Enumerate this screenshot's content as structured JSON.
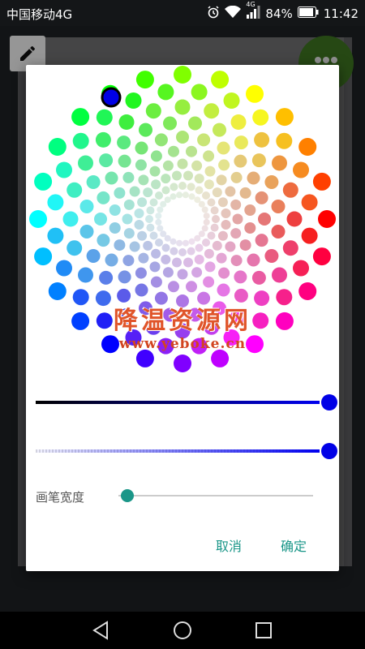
{
  "status_bar": {
    "carrier": "中国移动4G",
    "network_badge": "4G",
    "battery": "84%",
    "time": "11:42",
    "icons": [
      "alarm-icon",
      "wifi-icon",
      "signal-icon",
      "battery-icon"
    ]
  },
  "toolbar": {
    "pencil_icon": "pencil-icon",
    "menu_icon": "more-dots-icon",
    "fab_color": "#3b6f1f"
  },
  "dialog": {
    "selected_color": "#0000e6",
    "value_slider_level": 1.0,
    "alpha_slider_level": 1.0,
    "brush_width_label": "画笔宽度",
    "brush_width_level": 0.04,
    "cancel_label": "取消",
    "confirm_label": "确定",
    "accent_color": "#1a9688"
  },
  "watermark": {
    "title": "降温资源网",
    "url": "www.yeboke.cn"
  },
  "nav_bar": {
    "icons": [
      "back-icon",
      "home-icon",
      "recents-icon"
    ]
  }
}
